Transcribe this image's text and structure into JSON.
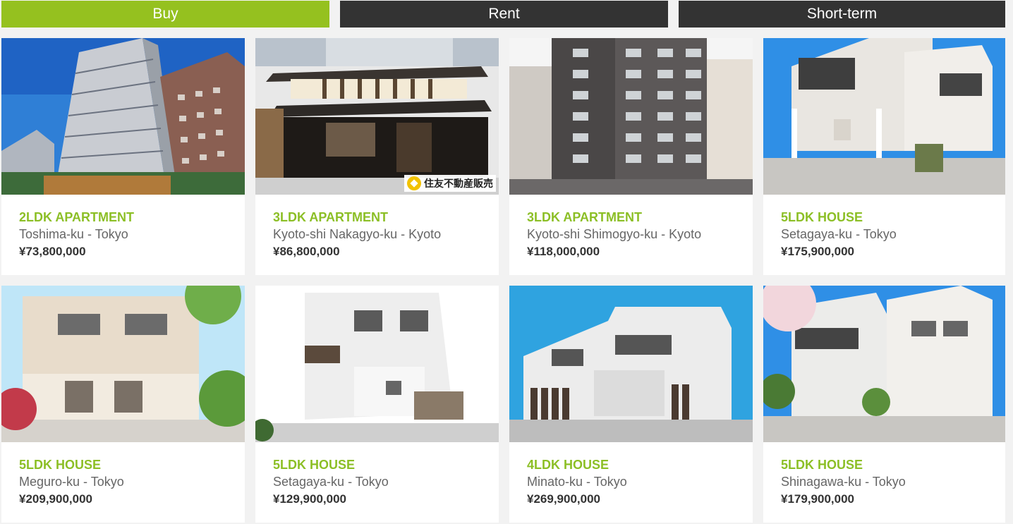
{
  "tabs": {
    "buy": "Buy",
    "rent": "Rent",
    "short_term": "Short-term"
  },
  "colors": {
    "accent": "#95c11f",
    "tab_inactive": "#333333",
    "type_text": "#8cbf26"
  },
  "listings": [
    {
      "type": "2LDK APARTMENT",
      "location": "Toshima-ku - Tokyo",
      "price": "¥73,800,000"
    },
    {
      "type": "3LDK APARTMENT",
      "location": "Kyoto-shi Nakagyo-ku - Kyoto",
      "price": "¥86,800,000",
      "watermark": "住友不動産販売"
    },
    {
      "type": "3LDK APARTMENT",
      "location": "Kyoto-shi Shimogyo-ku - Kyoto",
      "price": "¥118,000,000"
    },
    {
      "type": "5LDK HOUSE",
      "location": "Setagaya-ku - Tokyo",
      "price": "¥175,900,000"
    },
    {
      "type": "5LDK HOUSE",
      "location": "Meguro-ku - Tokyo",
      "price": "¥209,900,000"
    },
    {
      "type": "5LDK HOUSE",
      "location": "Setagaya-ku - Tokyo",
      "price": "¥129,900,000"
    },
    {
      "type": "4LDK HOUSE",
      "location": "Minato-ku - Tokyo",
      "price": "¥269,900,000"
    },
    {
      "type": "5LDK HOUSE",
      "location": "Shinagawa-ku - Tokyo",
      "price": "¥179,900,000"
    }
  ]
}
